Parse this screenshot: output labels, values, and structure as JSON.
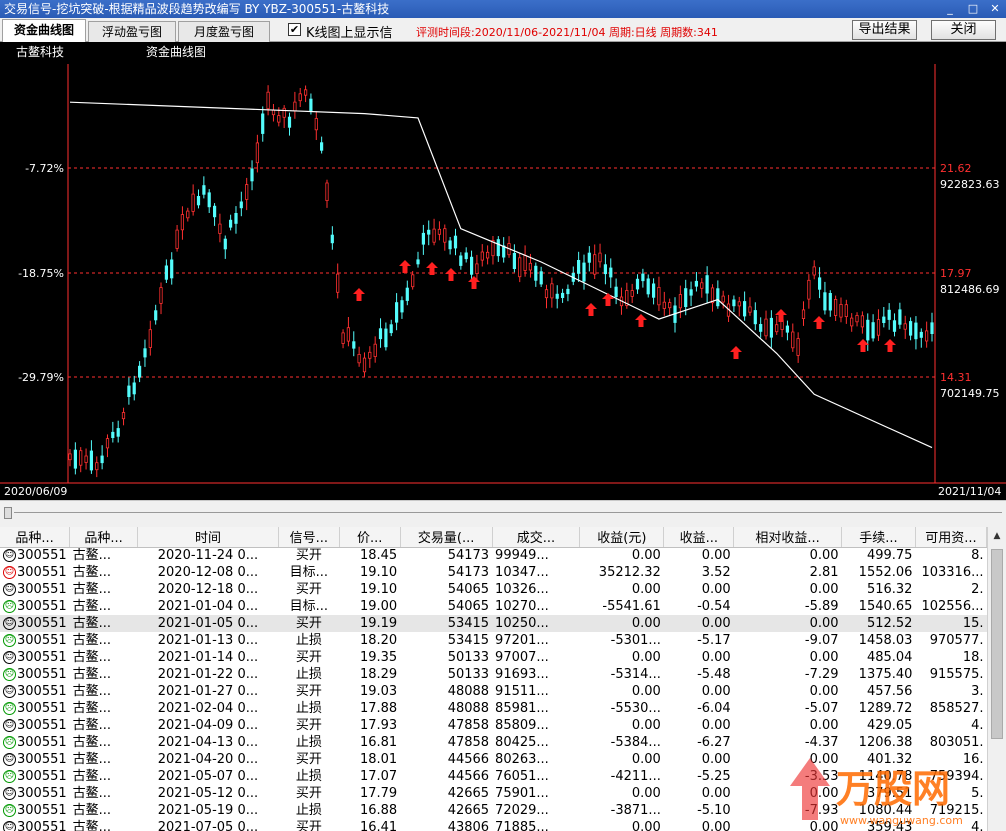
{
  "window": {
    "title": "交易信号-挖坑突破-根据精品波段趋势改编写 BY YBZ-300551-古鳌科技",
    "min_label": "_",
    "max_label": "□",
    "close_label": "✕"
  },
  "toolbar": {
    "tabs": [
      {
        "label": "资金曲线图",
        "active": true
      },
      {
        "label": "浮动盈亏图",
        "active": false
      },
      {
        "label": "月度盈亏图",
        "active": false
      }
    ],
    "kline_checkbox_checked": true,
    "kline_checkbox_label": "K线图上显示信",
    "eval_period": "评测时间段:2020/11/06-2021/11/04 周期:日线 周期数:341",
    "export_button": "导出结果",
    "close_button": "关闭"
  },
  "chart_panel": {
    "stock_name": "古鳌科技",
    "curve_title": "资金曲线图",
    "date_start": "2020/06/09",
    "date_end": "2021/11/04",
    "left_axis_labels": [
      "-7.72%",
      "-18.75%",
      "-29.79%"
    ],
    "right_price_labels": [
      "21.62",
      "17.97",
      "14.31"
    ],
    "right_equity_labels": [
      "922823.63",
      "812486.69",
      "702149.75"
    ],
    "colors": {
      "up": "#ff3030",
      "down": "#54fcfc",
      "equity": "#ffffff",
      "grid": "#ff3030",
      "signal": "#ff2020"
    }
  },
  "chart_data": {
    "type": "line",
    "title": "资金曲线图",
    "series": [
      {
        "name": "资金曲线",
        "x": [
          1,
          56,
          66,
          74,
          89,
          111,
          122,
          133,
          140,
          162
        ],
        "values": [
          992000,
          980000,
          975500,
          859000,
          824000,
          764000,
          784500,
          728000,
          685000,
          629000
        ]
      }
    ],
    "right_scale": [
      702149.75,
      812486.69,
      922823.63
    ],
    "buy_signals": 18
  },
  "table": {
    "headers": [
      "品种...",
      "品种...",
      "时间",
      "信号...",
      "价...",
      "交易量(...",
      "成交...",
      "收益(元)",
      "收益...",
      "相对收益...",
      "手续...",
      "可用资..."
    ],
    "rows": [
      {
        "face": "neutral",
        "code": "300551",
        "name": "古鳌...",
        "time": "2020-11-24 0...",
        "signal": "买开",
        "price": "18.45",
        "volume": "54173",
        "amount": "99949...",
        "profit": "0.00",
        "profit_pct": "0.00",
        "rel_profit": "0.00",
        "fee": "499.75",
        "avail": "8."
      },
      {
        "face": "happy",
        "code": "300551",
        "name": "古鳌...",
        "time": "2020-12-08 0...",
        "signal": "目标...",
        "price": "19.10",
        "volume": "54173",
        "amount": "10347...",
        "profit": "35212.32",
        "profit_pct": "3.52",
        "rel_profit": "2.81",
        "fee": "1552.06",
        "avail": "103316..."
      },
      {
        "face": "neutral",
        "code": "300551",
        "name": "古鳌...",
        "time": "2020-12-18 0...",
        "signal": "买开",
        "price": "19.10",
        "volume": "54065",
        "amount": "10326...",
        "profit": "0.00",
        "profit_pct": "0.00",
        "rel_profit": "0.00",
        "fee": "516.32",
        "avail": "2."
      },
      {
        "face": "sad",
        "code": "300551",
        "name": "古鳌...",
        "time": "2021-01-04 0...",
        "signal": "目标...",
        "price": "19.00",
        "volume": "54065",
        "amount": "10270...",
        "profit": "-5541.61",
        "profit_pct": "-0.54",
        "rel_profit": "-5.89",
        "fee": "1540.65",
        "avail": "102556..."
      },
      {
        "face": "neutral",
        "code": "300551",
        "name": "古鳌...",
        "time": "2021-01-05 0...",
        "signal": "买开",
        "price": "19.19",
        "volume": "53415",
        "amount": "10250...",
        "profit": "0.00",
        "profit_pct": "0.00",
        "rel_profit": "0.00",
        "fee": "512.52",
        "avail": "15.",
        "selected": true
      },
      {
        "face": "sad",
        "code": "300551",
        "name": "古鳌...",
        "time": "2021-01-13 0...",
        "signal": "止损",
        "price": "18.20",
        "volume": "53415",
        "amount": "97201...",
        "profit": "-5301...",
        "profit_pct": "-5.17",
        "rel_profit": "-9.07",
        "fee": "1458.03",
        "avail": "970577."
      },
      {
        "face": "neutral",
        "code": "300551",
        "name": "古鳌...",
        "time": "2021-01-14 0...",
        "signal": "买开",
        "price": "19.35",
        "volume": "50133",
        "amount": "97007...",
        "profit": "0.00",
        "profit_pct": "0.00",
        "rel_profit": "0.00",
        "fee": "485.04",
        "avail": "18."
      },
      {
        "face": "sad",
        "code": "300551",
        "name": "古鳌...",
        "time": "2021-01-22 0...",
        "signal": "止损",
        "price": "18.29",
        "volume": "50133",
        "amount": "91693...",
        "profit": "-5314...",
        "profit_pct": "-5.48",
        "rel_profit": "-7.29",
        "fee": "1375.40",
        "avail": "915575."
      },
      {
        "face": "neutral",
        "code": "300551",
        "name": "古鳌...",
        "time": "2021-01-27 0...",
        "signal": "买开",
        "price": "19.03",
        "volume": "48088",
        "amount": "91511...",
        "profit": "0.00",
        "profit_pct": "0.00",
        "rel_profit": "0.00",
        "fee": "457.56",
        "avail": "3."
      },
      {
        "face": "sad",
        "code": "300551",
        "name": "古鳌...",
        "time": "2021-02-04 0...",
        "signal": "止损",
        "price": "17.88",
        "volume": "48088",
        "amount": "85981...",
        "profit": "-5530...",
        "profit_pct": "-6.04",
        "rel_profit": "-5.07",
        "fee": "1289.72",
        "avail": "858527."
      },
      {
        "face": "neutral",
        "code": "300551",
        "name": "古鳌...",
        "time": "2021-04-09 0...",
        "signal": "买开",
        "price": "17.93",
        "volume": "47858",
        "amount": "85809...",
        "profit": "0.00",
        "profit_pct": "0.00",
        "rel_profit": "0.00",
        "fee": "429.05",
        "avail": "4."
      },
      {
        "face": "sad",
        "code": "300551",
        "name": "古鳌...",
        "time": "2021-04-13 0...",
        "signal": "止损",
        "price": "16.81",
        "volume": "47858",
        "amount": "80425...",
        "profit": "-5384...",
        "profit_pct": "-6.27",
        "rel_profit": "-4.37",
        "fee": "1206.38",
        "avail": "803051."
      },
      {
        "face": "neutral",
        "code": "300551",
        "name": "古鳌...",
        "time": "2021-04-20 0...",
        "signal": "买开",
        "price": "18.01",
        "volume": "44566",
        "amount": "80263...",
        "profit": "0.00",
        "profit_pct": "0.00",
        "rel_profit": "0.00",
        "fee": "401.32",
        "avail": "16."
      },
      {
        "face": "sad",
        "code": "300551",
        "name": "古鳌...",
        "time": "2021-05-07 0...",
        "signal": "止损",
        "price": "17.07",
        "volume": "44566",
        "amount": "76051...",
        "profit": "-4211...",
        "profit_pct": "-5.25",
        "rel_profit": "-3.53",
        "fee": "1140.78",
        "avail": "759394."
      },
      {
        "face": "neutral",
        "code": "300551",
        "name": "古鳌...",
        "time": "2021-05-12 0...",
        "signal": "买开",
        "price": "17.79",
        "volume": "42665",
        "amount": "75901...",
        "profit": "0.00",
        "profit_pct": "0.00",
        "rel_profit": "0.00",
        "fee": "379.51",
        "avail": "5."
      },
      {
        "face": "sad",
        "code": "300551",
        "name": "古鳌...",
        "time": "2021-05-19 0...",
        "signal": "止损",
        "price": "16.88",
        "volume": "42665",
        "amount": "72029...",
        "profit": "-3871...",
        "profit_pct": "-5.10",
        "rel_profit": "-7.93",
        "fee": "1080.44",
        "avail": "719215."
      },
      {
        "face": "neutral",
        "code": "300551",
        "name": "古鳌...",
        "time": "2021-07-05 0...",
        "signal": "买开",
        "price": "16.41",
        "volume": "43806",
        "amount": "71885...",
        "profit": "0.00",
        "profit_pct": "0.00",
        "rel_profit": "0.00",
        "fee": "359.43",
        "avail": "4."
      }
    ]
  },
  "watermark": {
    "text": "万股网",
    "url": "www.wanguwang.com"
  }
}
